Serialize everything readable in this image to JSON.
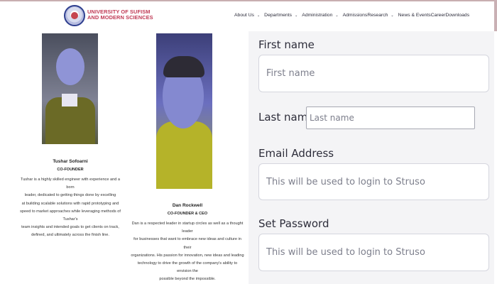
{
  "header": {
    "brand_line1": "UNIVERSITY OF SUFISM",
    "brand_line2": "AND MODERN SCIENCES",
    "nav": [
      {
        "label": "About Us",
        "caret": true
      },
      {
        "label": "Departments",
        "caret": true
      },
      {
        "label": "Administration",
        "caret": true
      },
      {
        "label": "AdmissionsResearch",
        "caret": true
      },
      {
        "label": "News & EventsCareerDownloads",
        "caret": false
      }
    ],
    "caret_glyph": "⌄"
  },
  "team": [
    {
      "name": "Tushar Sofoarni",
      "role": "CO-FOUNDER",
      "bio": [
        "Tushar is a highly skilled engineer with experience and a born",
        "leader, dedicated to getting things done by excelling",
        "at building scalable solutions with rapid prototyping and",
        "speed to market approaches while leveraging methods of Tushar's",
        "team insights and intended goals to get clients on track,",
        "defined, and ultimately across the finish line."
      ]
    },
    {
      "name": "Dan Rockwell",
      "role": "CO-FOUNDER & CEO",
      "bio": [
        "Dan is a respected leader in startup circles as well as a thought leader",
        "for businesses that want to embrace new ideas and culture in their",
        "organizations. His passion for innovation, new ideas and leading",
        "technology to drive the growth of the company's ability to envision the",
        "possible beyond the impossible."
      ]
    }
  ],
  "form": {
    "first_name_label": "First name",
    "first_name_placeholder": "First name",
    "last_name_label": "Last name",
    "last_name_placeholder": "Last name",
    "email_label": "Email Address",
    "email_placeholder": "This will be used to login to Struso",
    "password_label": "Set Password",
    "password_placeholder": "This will be used to login to Struso"
  },
  "colors": {
    "brand": "#c03a55",
    "form_bg": "#f4f4f6",
    "field_border": "#d5d6de"
  }
}
